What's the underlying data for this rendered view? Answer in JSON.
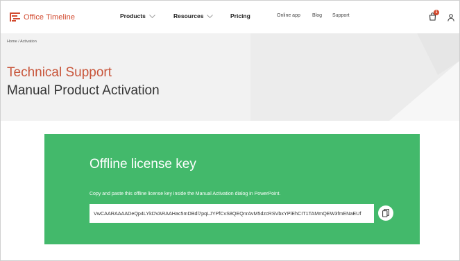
{
  "header": {
    "logo_text": "Office Timeline",
    "nav": [
      {
        "label": "Products"
      },
      {
        "label": "Resources"
      },
      {
        "label": "Pricing"
      }
    ],
    "links": [
      {
        "label": "Online app"
      },
      {
        "label": "Blog"
      },
      {
        "label": "Support"
      }
    ],
    "cart_count": "1",
    "icons": [
      "cart-icon",
      "user-icon",
      "chevron-down-icon"
    ]
  },
  "hero": {
    "breadcrumb": "Home / Activation",
    "title": "Technical Support",
    "subtitle": "Manual Product Activation"
  },
  "card": {
    "title": "Offline license key",
    "description": "Copy and paste this offline license key inside the Manual Activation dialog in PowerPoint.",
    "license_key": "VwCAARAAAADeQp4LYkDVARAAHac5mDBdl7pqLJYPfCvS8QEQnrAvM5dzcRSVbxYPiEhCIT1TAMmQEW3fmENaEUf",
    "copy_icon": "copy-icon"
  },
  "colors": {
    "brand": "#d24a2f",
    "card_green": "#43b96b",
    "hero_bg": "#f2f2f2"
  }
}
